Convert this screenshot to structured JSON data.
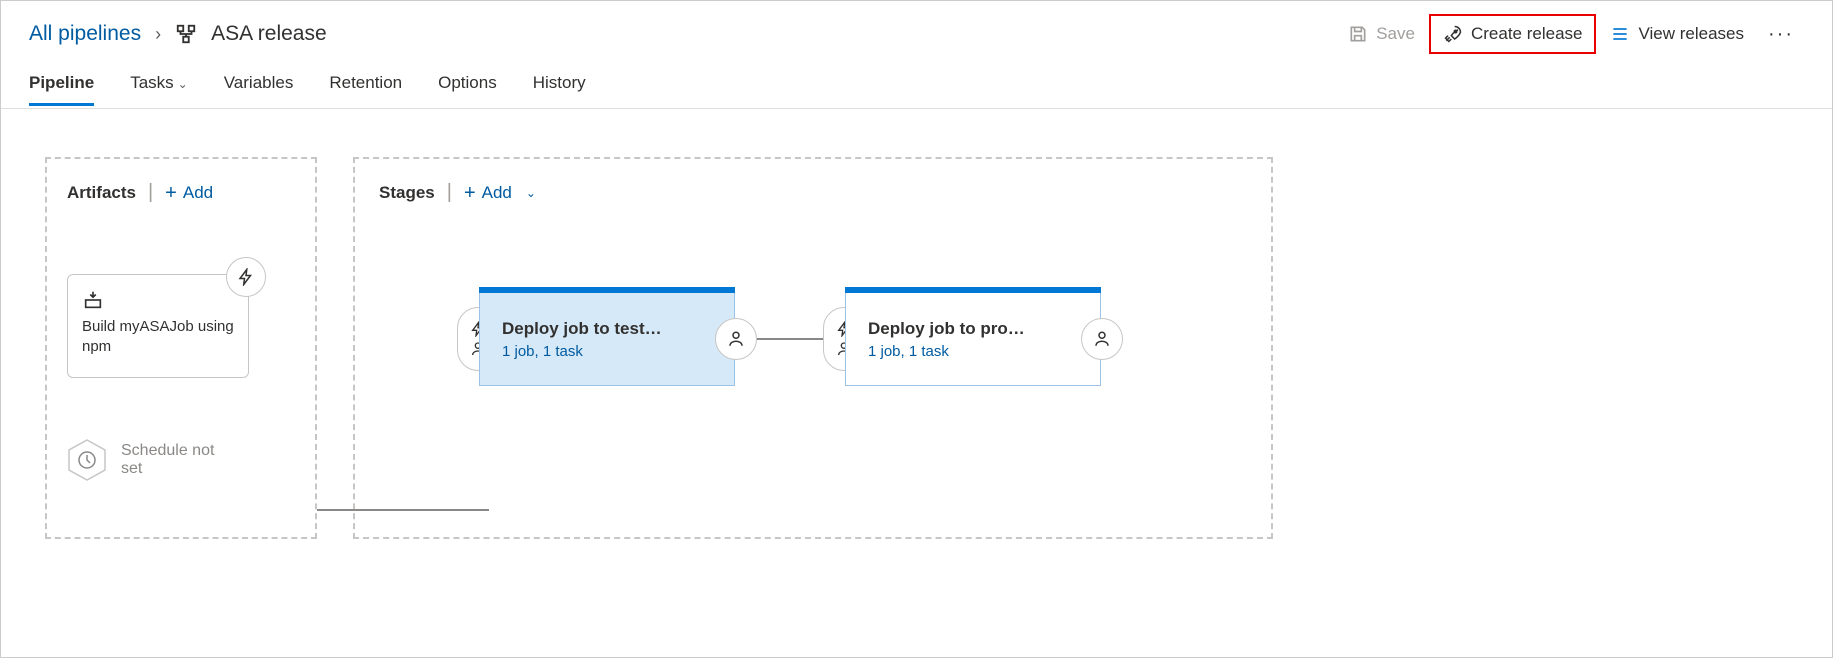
{
  "breadcrumb": {
    "root": "All pipelines",
    "current": "ASA release"
  },
  "header_actions": {
    "save": "Save",
    "create_release": "Create release",
    "view_releases": "View releases"
  },
  "tabs": {
    "pipeline": "Pipeline",
    "tasks": "Tasks",
    "variables": "Variables",
    "retention": "Retention",
    "options": "Options",
    "history": "History"
  },
  "artifacts": {
    "heading": "Artifacts",
    "add": "Add",
    "card_title": "Build myASAJob using npm",
    "schedule_label": "Schedule not set"
  },
  "stages": {
    "heading": "Stages",
    "add": "Add",
    "items": [
      {
        "title": "Deploy job to test…",
        "subtitle": "1 job, 1 task",
        "selected": true
      },
      {
        "title": "Deploy job to pro…",
        "subtitle": "1 job, 1 task",
        "selected": false
      }
    ]
  }
}
